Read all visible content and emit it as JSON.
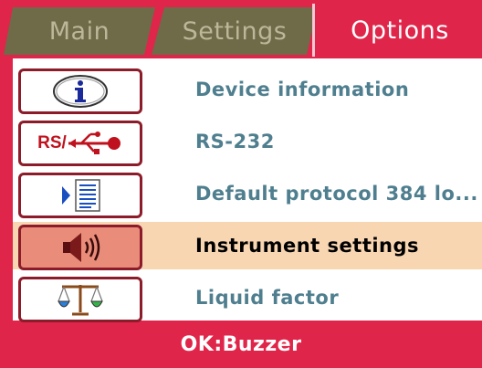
{
  "tabs": [
    {
      "label": "Main"
    },
    {
      "label": "Settings"
    },
    {
      "label": "Options"
    }
  ],
  "menu": {
    "items": [
      {
        "label": "Device information",
        "icon": "info-icon"
      },
      {
        "label": "RS-232",
        "icon": "rs232-usb-icon",
        "icon_text": "RS/"
      },
      {
        "label": "Default protocol 384 lo...",
        "icon": "protocol-list-icon"
      },
      {
        "label": "Instrument settings",
        "icon": "speaker-icon",
        "selected": true
      },
      {
        "label": "Liquid factor",
        "icon": "balance-scale-icon"
      }
    ]
  },
  "footer": {
    "hint": "OK:Buzzer"
  },
  "colors": {
    "accent": "#e0254a",
    "selected_row": "#f9d6b2",
    "inactive_tab": "#6f6a48",
    "label": "#4f7f8f"
  }
}
